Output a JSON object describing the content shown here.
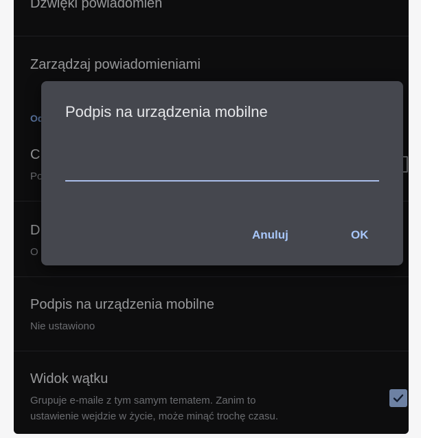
{
  "settings": {
    "notification_sounds": "Dźwięki powiadomień",
    "manage_notifications": "Zarządzaj powiadomieniami",
    "partial_accent": "Od",
    "partial_row_c_title": "C",
    "partial_row_c_sub": "Po",
    "partial_row_d_title": "D",
    "partial_row_d_sub": "O",
    "mobile_signature": {
      "title": "Podpis na urządzenia mobilne",
      "value": "Nie ustawiono"
    },
    "thread_view": {
      "title": "Widok wątku",
      "description_line1": "Grupuje e-maile z tym samym tematem. Zanim to",
      "description_line2": "ustawienie wejdzie w życie, może minąć trochę czasu.",
      "checked": true
    }
  },
  "dialog": {
    "title": "Podpis na urządzenia mobilne",
    "input_value": "",
    "cancel_label": "Anuluj",
    "ok_label": "OK"
  },
  "colors": {
    "background": "#141416",
    "dialog": "#45474e",
    "accent": "#a8c7fa"
  }
}
